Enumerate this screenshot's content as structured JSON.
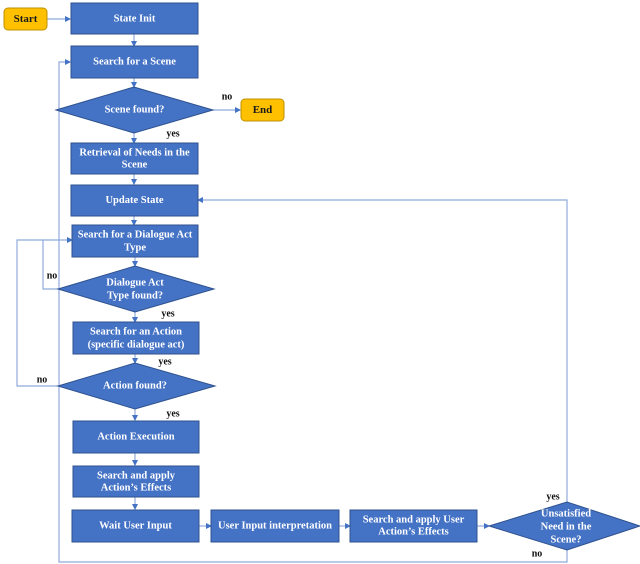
{
  "diagram": {
    "type": "flowchart",
    "colors": {
      "process": "#4472c4",
      "terminal": "#ffc000",
      "connector": "#8faadc"
    },
    "terminals": {
      "start": "Start",
      "end": "End"
    },
    "nodes": {
      "state_init": "State Init",
      "search_scene": "Search for a Scene",
      "scene_found": "Scene found?",
      "retrieval_1": "Retrieval of Needs in the",
      "retrieval_2": "Scene",
      "update_state": "Update State",
      "search_dat_1": "Search for a Dialogue Act",
      "search_dat_2": "Type",
      "dat_found_1": "Dialogue Act",
      "dat_found_2": "Type found?",
      "search_action_1": "Search for an Action",
      "search_action_2": "(specific dialogue act)",
      "action_found": "Action found?",
      "action_exec": "Action Execution",
      "apply_effects_1": "Search and apply",
      "apply_effects_2": "Action’s Effects",
      "wait_input": "Wait User Input",
      "input_interp": "User Input interpretation",
      "user_effects_1": "Search and apply User",
      "user_effects_2": "Action’s Effects",
      "unsat_1": "Unsatisfied",
      "unsat_2": "Need in the",
      "unsat_3": "Scene?"
    },
    "labels": {
      "scene_no": "no",
      "scene_yes": "yes",
      "dat_no": "no",
      "dat_yes": "yes",
      "action_yes_top": "yes",
      "action_no": "no",
      "action_yes": "yes",
      "unsat_yes": "yes",
      "unsat_no": "no"
    }
  }
}
